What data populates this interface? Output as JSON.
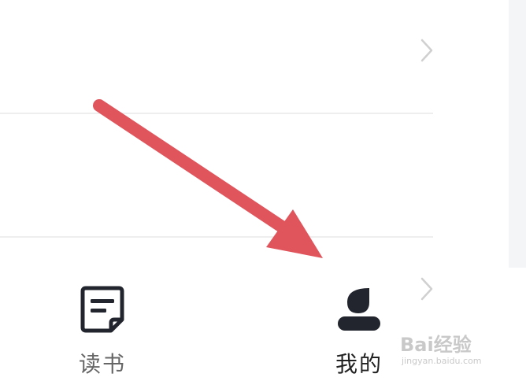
{
  "tabbar": {
    "tabs": [
      {
        "label": "读书",
        "icon": "book-note-icon"
      },
      {
        "label": "我的",
        "icon": "profile-icon"
      }
    ]
  },
  "watermark": {
    "logo_text": "Bai经验",
    "sub_text": "jingyan.baidu.com"
  },
  "colors": {
    "arrow": "#e0545c",
    "icon_dark": "#22252d",
    "divider": "#eeeeee",
    "chevron": "#d0d0d0"
  }
}
